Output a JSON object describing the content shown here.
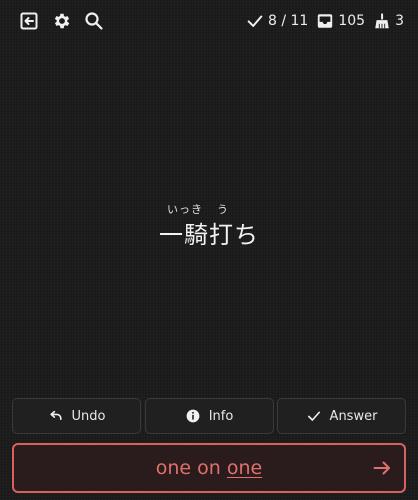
{
  "topbar": {
    "icons": [
      "exit-icon",
      "gear-icon",
      "search-icon"
    ],
    "stats": {
      "done": "8 / 11",
      "inbox": "105",
      "wipe": "3"
    }
  },
  "card": {
    "furigana": [
      "いっき",
      "う"
    ],
    "word": "一騎打ち"
  },
  "actions": {
    "undo": "Undo",
    "info": "Info",
    "answer": "Answer"
  },
  "input": {
    "value_before": "one on ",
    "value_underlined": "one",
    "submit_icon": "arrow-right-icon"
  },
  "colors": {
    "background": "#1a1a1a",
    "accent_wrong": "#d9605f"
  }
}
